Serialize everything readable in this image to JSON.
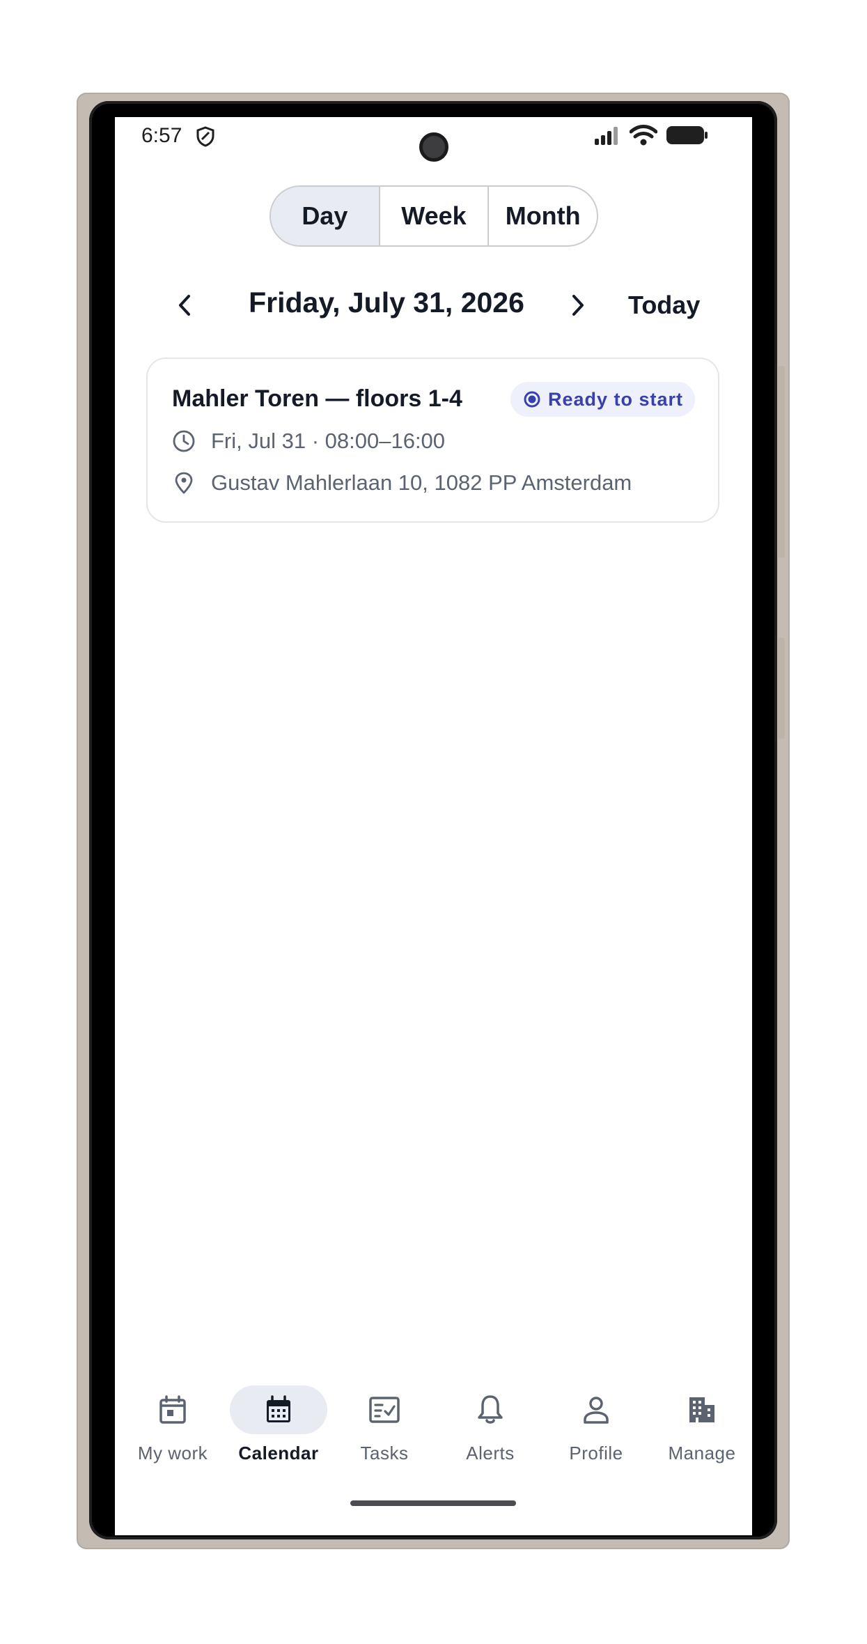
{
  "status_bar": {
    "time": "6:57"
  },
  "view_switcher": {
    "options": [
      "Day",
      "Week",
      "Month"
    ],
    "selected": "Day"
  },
  "date_nav": {
    "title": "Friday, July 31, 2026",
    "today_label": "Today"
  },
  "event_card": {
    "title": "Mahler Toren — floors 1-4",
    "status": "Ready to start",
    "time": "Fri, Jul 31 · 08:00–16:00",
    "location": "Gustav Mahlerlaan 10, 1082 PP Amsterdam"
  },
  "bottom_nav": {
    "items": [
      {
        "label": "My work",
        "icon": "my-work-icon"
      },
      {
        "label": "Calendar",
        "icon": "calendar-icon"
      },
      {
        "label": "Tasks",
        "icon": "tasks-icon"
      },
      {
        "label": "Alerts",
        "icon": "bell-icon"
      },
      {
        "label": "Profile",
        "icon": "person-icon"
      },
      {
        "label": "Manage",
        "icon": "building-icon"
      }
    ],
    "selected": "Calendar"
  },
  "colors": {
    "accent": "#3840ab",
    "badge_bg": "#eef0fb",
    "selected_bg": "#e8ebf1",
    "text_primary": "#141a26",
    "text_secondary": "#5b6370"
  }
}
